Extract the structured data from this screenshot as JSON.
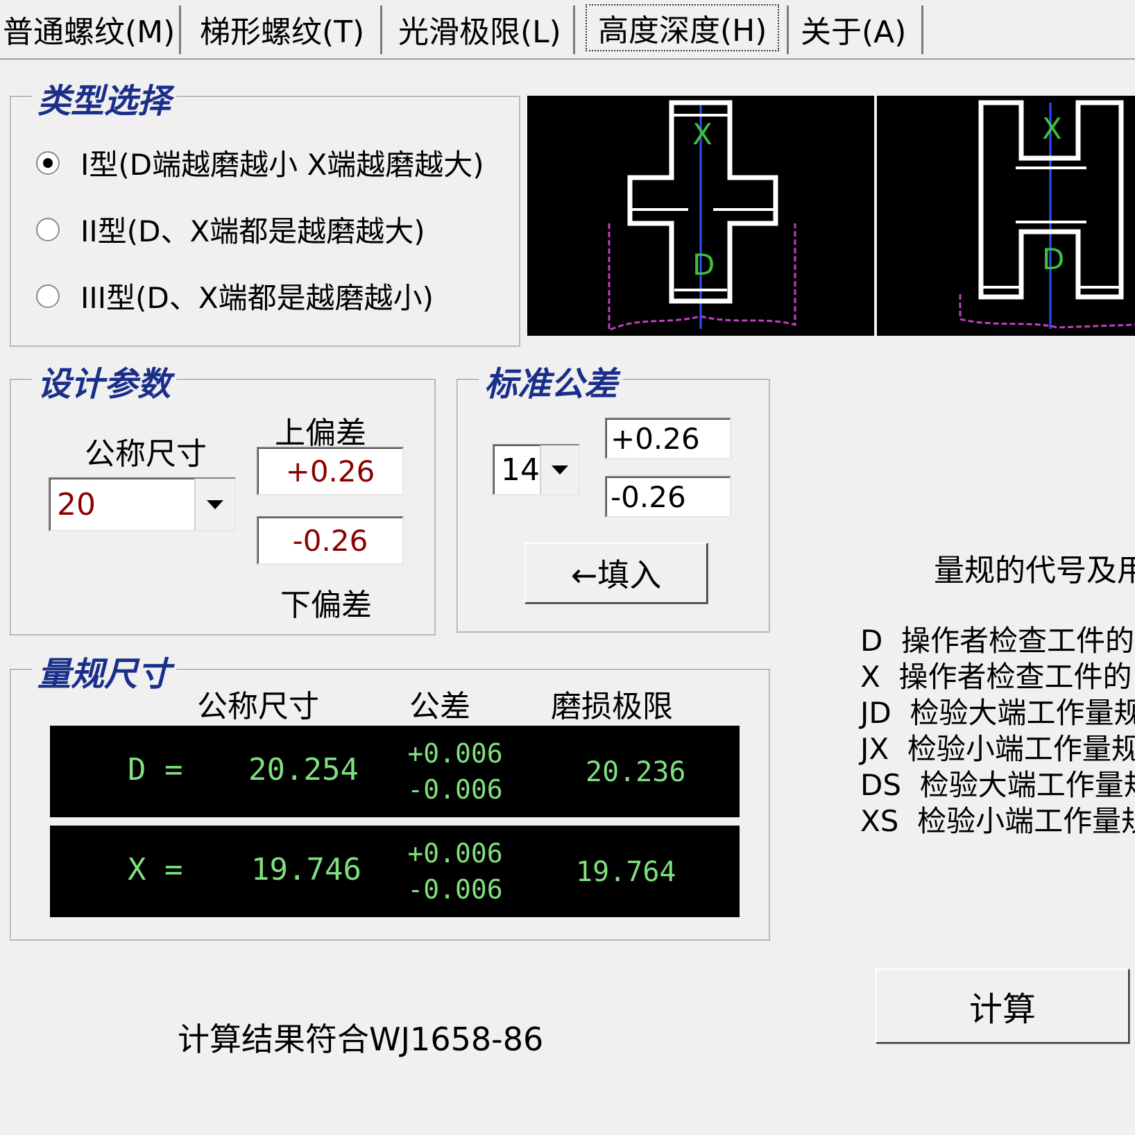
{
  "tabs": [
    {
      "label": "普通螺纹(M)"
    },
    {
      "label": "梯形螺纹(T)"
    },
    {
      "label": "光滑极限(L)"
    },
    {
      "label": "高度深度(H)"
    },
    {
      "label": "关于(A)"
    }
  ],
  "type_select": {
    "title": "类型选择",
    "options": [
      {
        "label": "I型(D端越磨越小 X端越磨越大)",
        "checked": true
      },
      {
        "label": "II型(D、X端都是越磨越大)",
        "checked": false
      },
      {
        "label": "III型(D、X端都是越磨越小)",
        "checked": false
      }
    ]
  },
  "design_params": {
    "title": "设计参数",
    "nominal_label": "公称尺寸",
    "nominal_value": "20",
    "upper_label": "上偏差",
    "upper_value": "+0.26",
    "lower_label": "下偏差",
    "lower_value": "-0.26"
  },
  "std_tol": {
    "title": "标准公差",
    "grade": "14",
    "upper": "+0.26",
    "lower": "-0.26",
    "fill_button": "←填入"
  },
  "gauge": {
    "title": "量规尺寸",
    "headers": [
      "公称尺寸",
      "公差",
      "磨损极限"
    ],
    "rows": [
      {
        "label": "D =",
        "nominal": "20.254",
        "tol_upper": "+0.006",
        "tol_lower": "-0.006",
        "wear": "20.236"
      },
      {
        "label": "X =",
        "nominal": "19.746",
        "tol_upper": "+0.006",
        "tol_lower": "-0.006",
        "wear": "19.764"
      }
    ]
  },
  "codes": {
    "title": "量规的代号及用",
    "items": [
      {
        "code": "D",
        "desc": "操作者检查工件的"
      },
      {
        "code": "X",
        "desc": "操作者检查工件的"
      },
      {
        "code": "JD",
        "desc": "检验大端工作量规"
      },
      {
        "code": "JX",
        "desc": "检验小端工作量规"
      },
      {
        "code": "DS",
        "desc": "检验大端工作量规"
      },
      {
        "code": "XS",
        "desc": "检验小端工作量规"
      }
    ]
  },
  "diagram": {
    "label_x": "X",
    "label_d": "D"
  },
  "footer": {
    "status": "计算结果符合WJ1658-86",
    "calc_button": "计算"
  },
  "colors": {
    "accent": "#1a2f8a",
    "result_text": "#7fe07f",
    "field_value": "#8b0000"
  }
}
